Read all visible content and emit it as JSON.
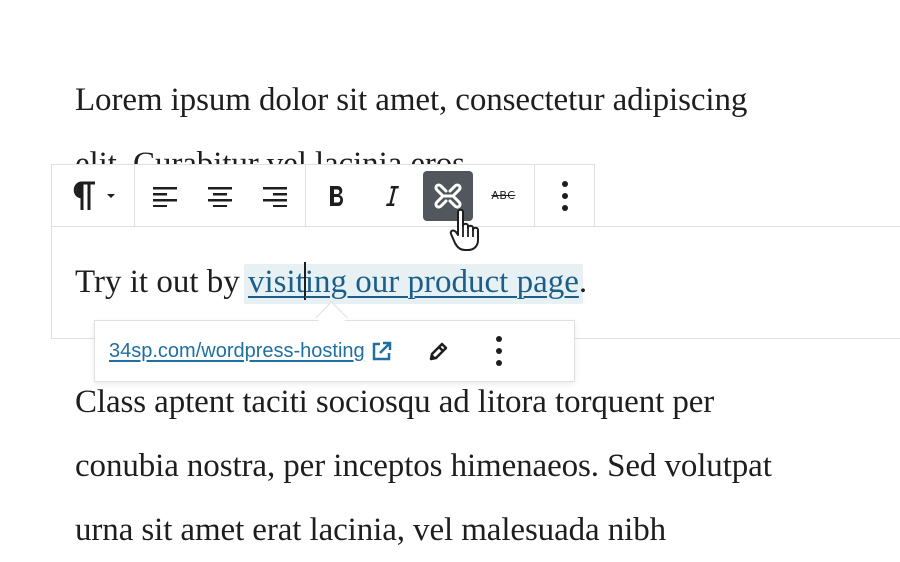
{
  "content": {
    "paragraph1_line1": "Lorem ipsum dolor sit amet, consectetur adipiscing",
    "paragraph1_line2": "elit. Curabitur vel lacinia eros.",
    "paragraph2_before": "Try it out by ",
    "paragraph2_link_a": "visit",
    "paragraph2_link_b": "ing our product page",
    "paragraph2_after": ".",
    "paragraph3_line1": "Class aptent taciti sociosqu ad litora torquent per",
    "paragraph3_line2": "conubia nostra, per inceptos himenaeos. Sed volutpat",
    "paragraph3_line3": "urna sit amet erat lacinia, vel malesuada nibh"
  },
  "toolbar": {
    "block_type_icon": "paragraph-icon",
    "items": [
      {
        "name": "align-left",
        "icon": "align-left-icon"
      },
      {
        "name": "align-center",
        "icon": "align-center-icon"
      },
      {
        "name": "align-right",
        "icon": "align-right-icon"
      },
      {
        "name": "bold",
        "icon": "bold-icon"
      },
      {
        "name": "italic",
        "icon": "italic-icon"
      },
      {
        "name": "unlink",
        "icon": "unlink-icon",
        "active": true
      },
      {
        "name": "strikethrough",
        "icon": "strikethrough-icon"
      },
      {
        "name": "more",
        "icon": "more-vertical-icon"
      }
    ],
    "strikethrough_label": "ABC"
  },
  "link_popover": {
    "url": "34sp.com/wordpress-hosting",
    "external_icon": "external-link-icon",
    "edit_icon": "pencil-icon",
    "more_icon": "more-vertical-icon"
  },
  "colors": {
    "link": "#1c5e8a",
    "link_highlight": "#e7f1f4",
    "active_button": "#51575d",
    "border": "#e0e0e0"
  }
}
